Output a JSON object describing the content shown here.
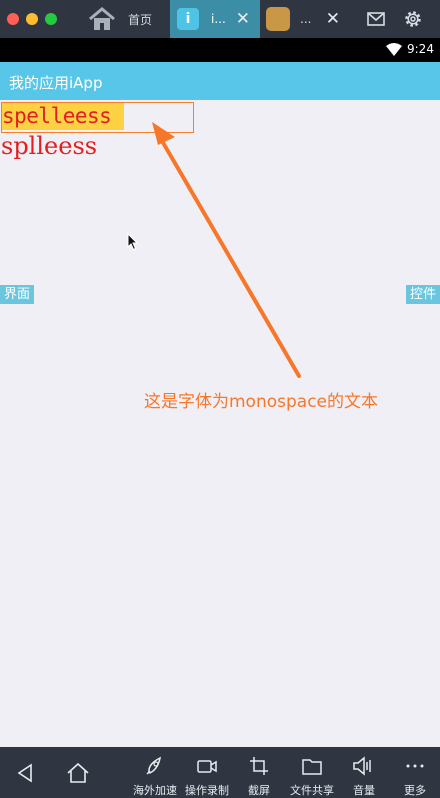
{
  "window": {
    "tabs": [
      {
        "label": "首页"
      },
      {
        "label": "i..."
      },
      {
        "label": "..."
      }
    ]
  },
  "status_bar": {
    "time": "9:24"
  },
  "app": {
    "title": "我的应用iApp",
    "text_monospace": "spelleess",
    "text_serif": "splleess",
    "left_button": "界面",
    "right_button": "控件",
    "annotation": "这是字体为monospace的文本"
  },
  "bottom_nav": {
    "items": [
      {
        "label": "海外加速"
      },
      {
        "label": "操作录制"
      },
      {
        "label": "截屏"
      },
      {
        "label": "文件共享"
      },
      {
        "label": "音量"
      },
      {
        "label": "更多"
      }
    ]
  },
  "colors": {
    "accent": "#58c6e8",
    "annotation": "#f6772a",
    "text_red": "#e02020",
    "highlight": "#fcd244"
  }
}
